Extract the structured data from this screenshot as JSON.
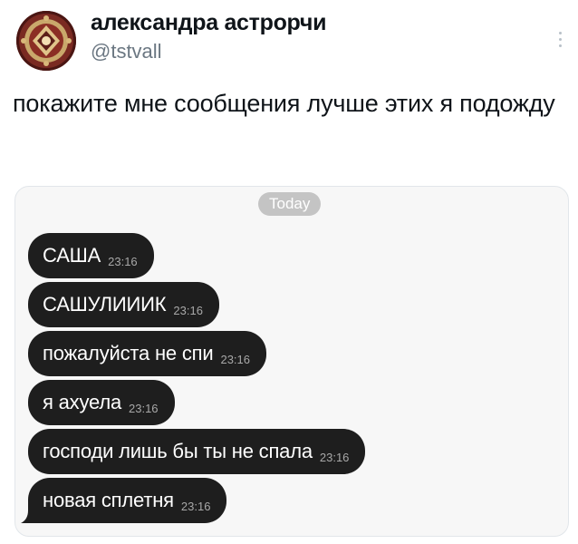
{
  "author": {
    "display_name": "александра астрорчи",
    "handle": "@tstvall"
  },
  "icons": {
    "avatar": "patterned-carpet-avatar",
    "more": "more-options-icon"
  },
  "tweet": {
    "text": "покажите мне сообщения лучше этих я подожду"
  },
  "chat_screenshot": {
    "date_label": "Today",
    "messages": [
      {
        "text": "САША",
        "time": "23:16"
      },
      {
        "text": "САШУЛИИИК",
        "time": "23:16"
      },
      {
        "text": "пожалуйста не спи",
        "time": "23:16"
      },
      {
        "text": "я ахуела",
        "time": "23:16"
      },
      {
        "text": "господи лишь бы ты не спала",
        "time": "23:16"
      },
      {
        "text": "новая сплетня",
        "time": "23:16"
      }
    ]
  },
  "colors": {
    "bubble": "#1e1e1e",
    "handle": "#6b7782",
    "date_pill": "#c4c4c4"
  }
}
